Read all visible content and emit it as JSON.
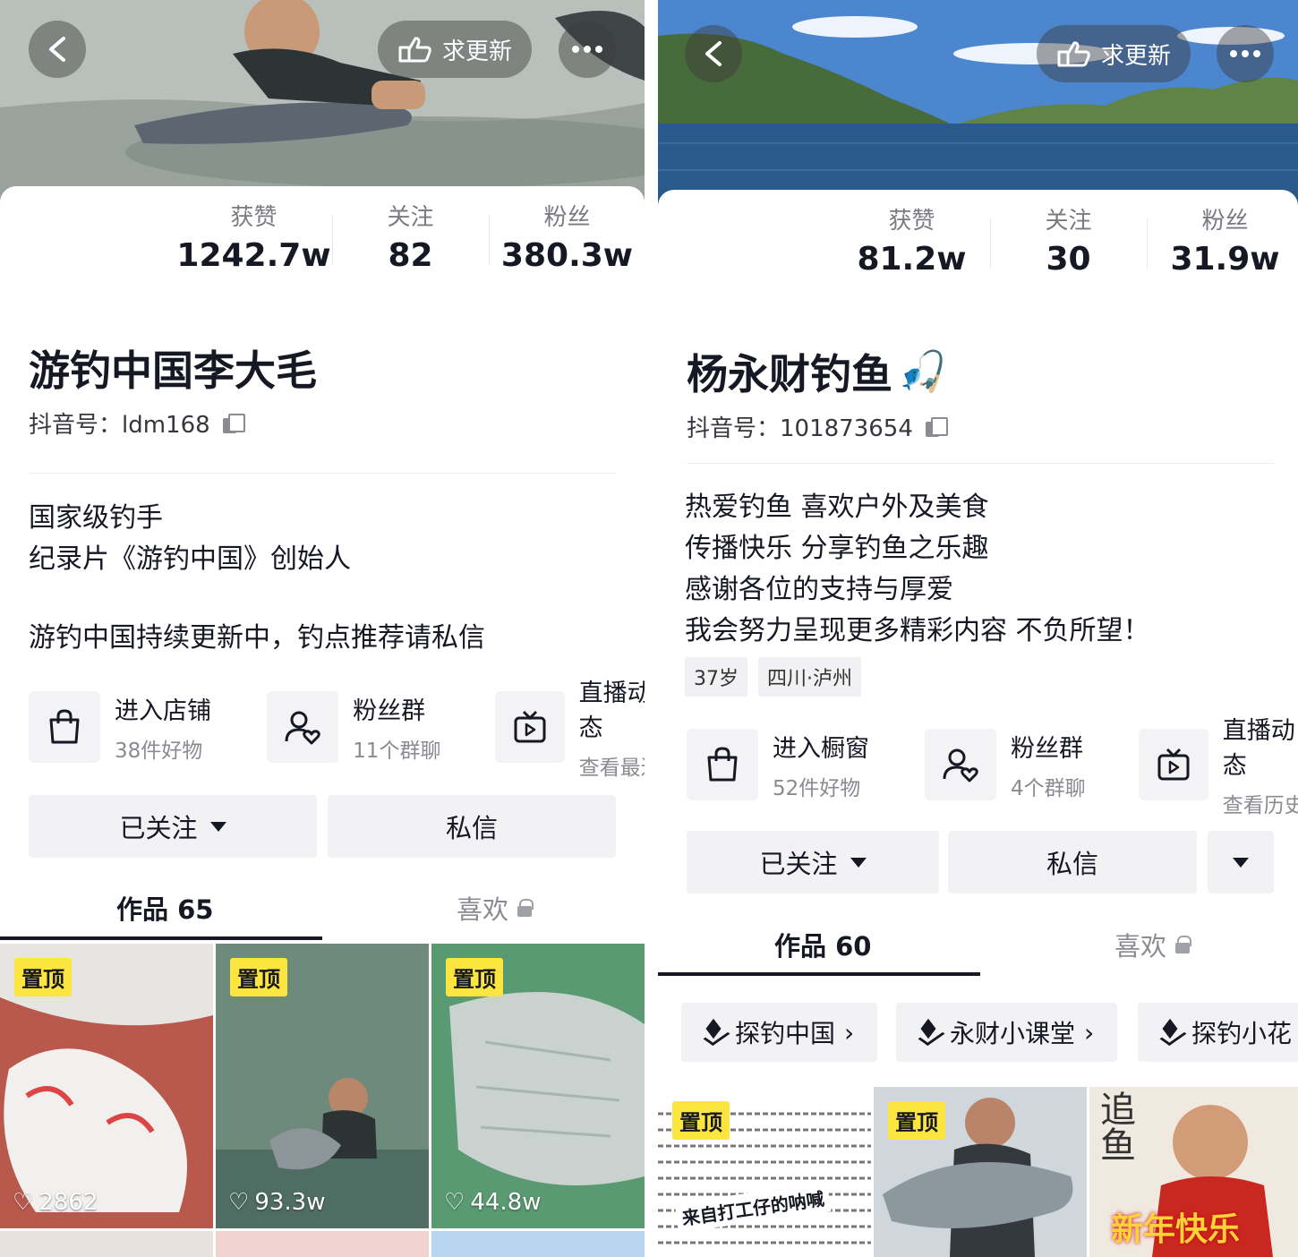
{
  "left": {
    "header": {
      "update_label": "求更新"
    },
    "stats": [
      {
        "label": "获赞",
        "value": "1242.7w"
      },
      {
        "label": "关注",
        "value": "82"
      },
      {
        "label": "粉丝",
        "value": "380.3w"
      }
    ],
    "name": "游钓中国李大毛",
    "uid": "抖音号：ldm168",
    "bio": [
      "国家级钓手",
      "纪录片《游钓中国》创始人",
      "",
      "游钓中国持续更新中，钓点推荐请私信"
    ],
    "entries": [
      {
        "title": "进入店铺",
        "sub": "38件好物"
      },
      {
        "title": "粉丝群",
        "sub": "11个群聊"
      },
      {
        "title": "直播动态",
        "sub": "查看最近"
      }
    ],
    "actions": {
      "follow": "已关注",
      "message": "私信"
    },
    "tabs": {
      "works": "作品 65",
      "likes": "喜欢"
    },
    "videos": [
      {
        "pin": "置顶",
        "likes": "2862"
      },
      {
        "pin": "置顶",
        "likes": "93.3w"
      },
      {
        "pin": "置顶",
        "likes": "44.8w"
      }
    ]
  },
  "right": {
    "header": {
      "update_label": "求更新"
    },
    "stats": [
      {
        "label": "获赞",
        "value": "81.2w"
      },
      {
        "label": "关注",
        "value": "30"
      },
      {
        "label": "粉丝",
        "value": "31.9w"
      }
    ],
    "name": "杨永财钓鱼",
    "name_emoji": "🎣",
    "uid": "抖音号：101873654",
    "bio": [
      "热爱钓鱼  喜欢户外及美食",
      "传播快乐  分享钓鱼之乐趣",
      "感谢各位的支持与厚爱",
      "我会努力呈现更多精彩内容 不负所望！"
    ],
    "tags": [
      "37岁",
      "四川·泸州"
    ],
    "entries": [
      {
        "title": "进入橱窗",
        "sub": "52件好物"
      },
      {
        "title": "粉丝群",
        "sub": "4个群聊"
      },
      {
        "title": "直播动态",
        "sub": "查看历史"
      }
    ],
    "actions": {
      "follow": "已关注",
      "message": "私信"
    },
    "tabs": {
      "works": "作品 60",
      "likes": "喜欢"
    },
    "collections": [
      "探钓中国",
      "永财小课堂",
      "探钓小花"
    ],
    "videos": [
      {
        "pin": "置顶",
        "caption": "来自打工仔的呐喊"
      },
      {
        "pin": "置顶"
      },
      {
        "banner": "新年快乐",
        "calligraphy": "追鱼"
      }
    ]
  },
  "colors": {
    "pin_bg": "#fce53f",
    "text": "#161823",
    "muted": "#8a8b90"
  }
}
